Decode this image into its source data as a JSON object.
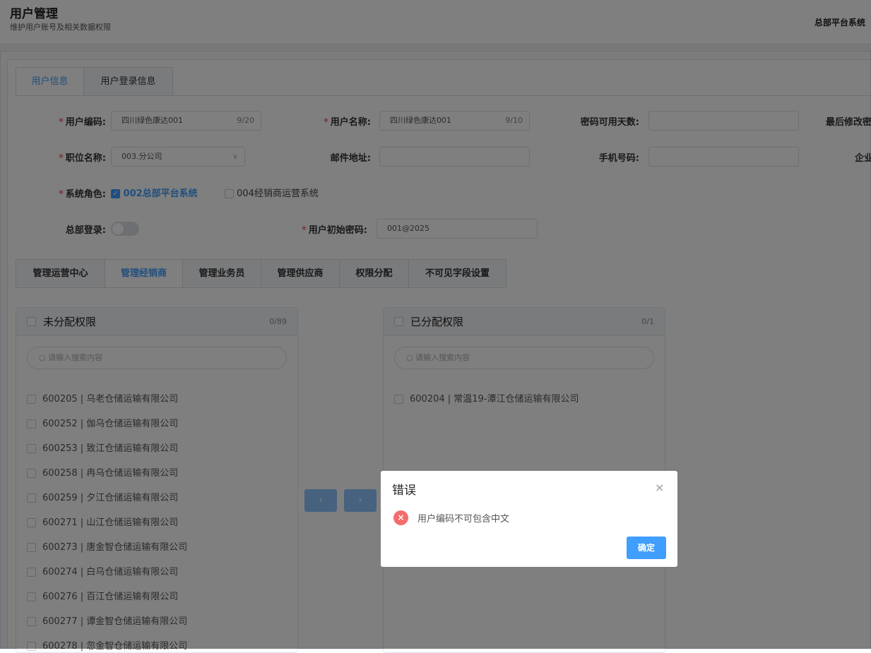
{
  "header": {
    "title": "用户管理",
    "subtitle": "维护用户账号及相关数据权限",
    "system": "总部平台系统"
  },
  "tabs": [
    "用户信息",
    "用户登录信息"
  ],
  "form": {
    "user_code": {
      "label": "用户编码:",
      "value": "四川绿色康达001",
      "count": "9/20"
    },
    "user_name": {
      "label": "用户名称:",
      "value": "四川绿色康达001",
      "count": "9/10"
    },
    "pwd_days": {
      "label": "密码可用天数:",
      "value": ""
    },
    "last_modified": {
      "label": "最后修改密"
    },
    "position": {
      "label": "职位名称:",
      "value": "003.分公司"
    },
    "email": {
      "label": "邮件地址:",
      "value": ""
    },
    "phone": {
      "label": "手机号码:",
      "value": ""
    },
    "enterprise": {
      "label": "企业"
    },
    "role": {
      "label": "系统角色:",
      "options": [
        {
          "label": "002总部平台系统",
          "checked": true
        },
        {
          "label": "004经销商运营系统",
          "checked": false
        }
      ]
    },
    "hq_login": {
      "label": "总部登录:",
      "on": false
    },
    "init_pwd": {
      "label": "用户初始密码:",
      "value": "001@2025"
    }
  },
  "subtabs": [
    "管理运营中心",
    "管理经销商",
    "管理业务员",
    "管理供应商",
    "权限分配",
    "不可见字段设置"
  ],
  "transfer": {
    "left": {
      "title": "未分配权限",
      "count": "0/89",
      "placeholder": "请输入搜索内容",
      "items": [
        "600205 | 乌老仓储运输有限公司",
        "600252 | 伽乌仓储运输有限公司",
        "600253 | 致江仓储运输有限公司",
        "600258 | 冉乌仓储运输有限公司",
        "600259 | 夕江仓储运输有限公司",
        "600271 | 山江仓储运输有限公司",
        "600273 | 唐金智仓储运输有限公司",
        "600274 | 白乌仓储运输有限公司",
        "600276 | 百江仓储运输有限公司",
        "600277 | 谭金智仓储运输有限公司",
        "600278 | 忽金智仓储运输有限公司"
      ]
    },
    "right": {
      "title": "已分配权限",
      "count": "0/1",
      "placeholder": "请输入搜索内容",
      "items": [
        "600204 | 常温19-潭江仓储运输有限公司"
      ]
    },
    "btn_left": "‹",
    "btn_right": "›"
  },
  "dialog": {
    "title": "错误",
    "message": "用户编码不可包含中文",
    "ok": "确定",
    "close": "×",
    "icon": "×"
  }
}
